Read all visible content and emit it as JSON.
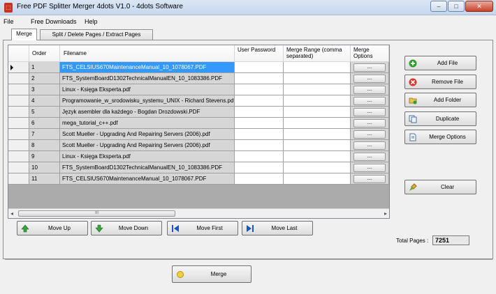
{
  "window": {
    "title": "Free PDF Splitter Merger 4dots V1.0 - 4dots Software",
    "icon": "pdf-app-icon"
  },
  "window_controls": {
    "minimize": "–",
    "maximize": "□",
    "close": "✕"
  },
  "menu": [
    "File",
    "Free Downloads",
    "Help"
  ],
  "tabs": [
    {
      "label": "Merge",
      "active": true
    },
    {
      "label": "Split / Delete Pages / Extract Pages",
      "active": false
    }
  ],
  "grid": {
    "columns": {
      "order": "Order",
      "filename": "Filename",
      "password": "User Password",
      "range": "Merge Range (comma separated)",
      "options": "Merge Options"
    },
    "option_button": "...",
    "scroll_grip": "III",
    "rows": [
      {
        "order": "1",
        "filename": "FTS_CELSIUS670MaintenanceManual_10_1078067.PDF",
        "password": "",
        "range": "",
        "selected": true
      },
      {
        "order": "2",
        "filename": "FTS_SystemBoardD1302TechnicalManualEN_10_1083386.PDF",
        "password": "",
        "range": ""
      },
      {
        "order": "3",
        "filename": "Linux - Księga Eksperta.pdf",
        "password": "",
        "range": ""
      },
      {
        "order": "4",
        "filename": "Programowanie_w_srodowisku_systemu_UNIX - Richard Stevens.pdf",
        "password": "",
        "range": ""
      },
      {
        "order": "5",
        "filename": "Język asembler dla każdego - Bogdan Drozdowski.PDF",
        "password": "",
        "range": ""
      },
      {
        "order": "6",
        "filename": "mega_tutorial_c++.pdf",
        "password": "",
        "range": ""
      },
      {
        "order": "7",
        "filename": "Scott Mueller - Upgrading And Repairing Servers (2006).pdf",
        "password": "",
        "range": ""
      },
      {
        "order": "8",
        "filename": "Scott Mueller - Upgrading And Repairing Servers (2006).pdf",
        "password": "",
        "range": ""
      },
      {
        "order": "9",
        "filename": "Linux - Księga Eksperta.pdf",
        "password": "",
        "range": ""
      },
      {
        "order": "10",
        "filename": "FTS_SystemBoardD1302TechnicalManualEN_10_1083386.PDF",
        "password": "",
        "range": ""
      },
      {
        "order": "11",
        "filename": "FTS_CELSIUS670MaintenanceManual_10_1078067.PDF",
        "password": "",
        "range": ""
      }
    ]
  },
  "side_buttons": {
    "add_file": "Add File",
    "remove_file": "Remove File",
    "add_folder": "Add Folder",
    "duplicate": "Duplicate",
    "merge_options": "Merge Options",
    "clear": "Clear"
  },
  "move_buttons": {
    "move_up": "Move Up",
    "move_down": "Move Down",
    "move_first": "Move First",
    "move_last": "Move Last"
  },
  "total_pages": {
    "label": "Total Pages :",
    "value": "7251"
  },
  "merge_button": "Merge",
  "colors": {
    "selection": "#3399ff",
    "grid_bg": "#ababab",
    "add_green": "#2e9e2e",
    "remove_red": "#d9352a",
    "move_blue": "#1a56c4"
  }
}
